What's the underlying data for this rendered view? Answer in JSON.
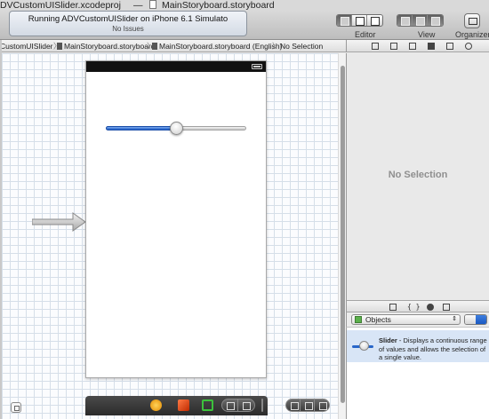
{
  "window": {
    "title_project": "DVCustomUISlider.xcodeproj",
    "title_dash": "—",
    "title_file": "MainStoryboard.storyboard"
  },
  "toolbar": {
    "activity": {
      "status": "Running ADVCustomUISlider on iPhone 6.1 Simulato",
      "issues": "No Issues"
    },
    "editor_label": "Editor",
    "view_label": "View",
    "organizer_label": "Organizer"
  },
  "jumpbar": {
    "crumbs": [
      "CustomUISlider",
      "MainStoryboard.storyboard",
      "MainStoryboard.storyboard (English)",
      "No Selection"
    ],
    "separator": "〉"
  },
  "canvas": {
    "slider": {
      "value": 0.5,
      "min": 0,
      "max": 1
    }
  },
  "inspector": {
    "empty_text": "No Selection"
  },
  "library": {
    "tabs": [
      "file-icon",
      "braces-icon",
      "cube-icon",
      "media-icon"
    ],
    "popup_label": "Objects",
    "items": [
      {
        "name": "Slider",
        "description": " - Displays a continuous range of values and allows the selection of a single value."
      }
    ]
  },
  "colors": {
    "slider_fill": "#1e5bc6",
    "selection": "#d8e5f6",
    "canvas_grid": "#d6dfe9"
  }
}
